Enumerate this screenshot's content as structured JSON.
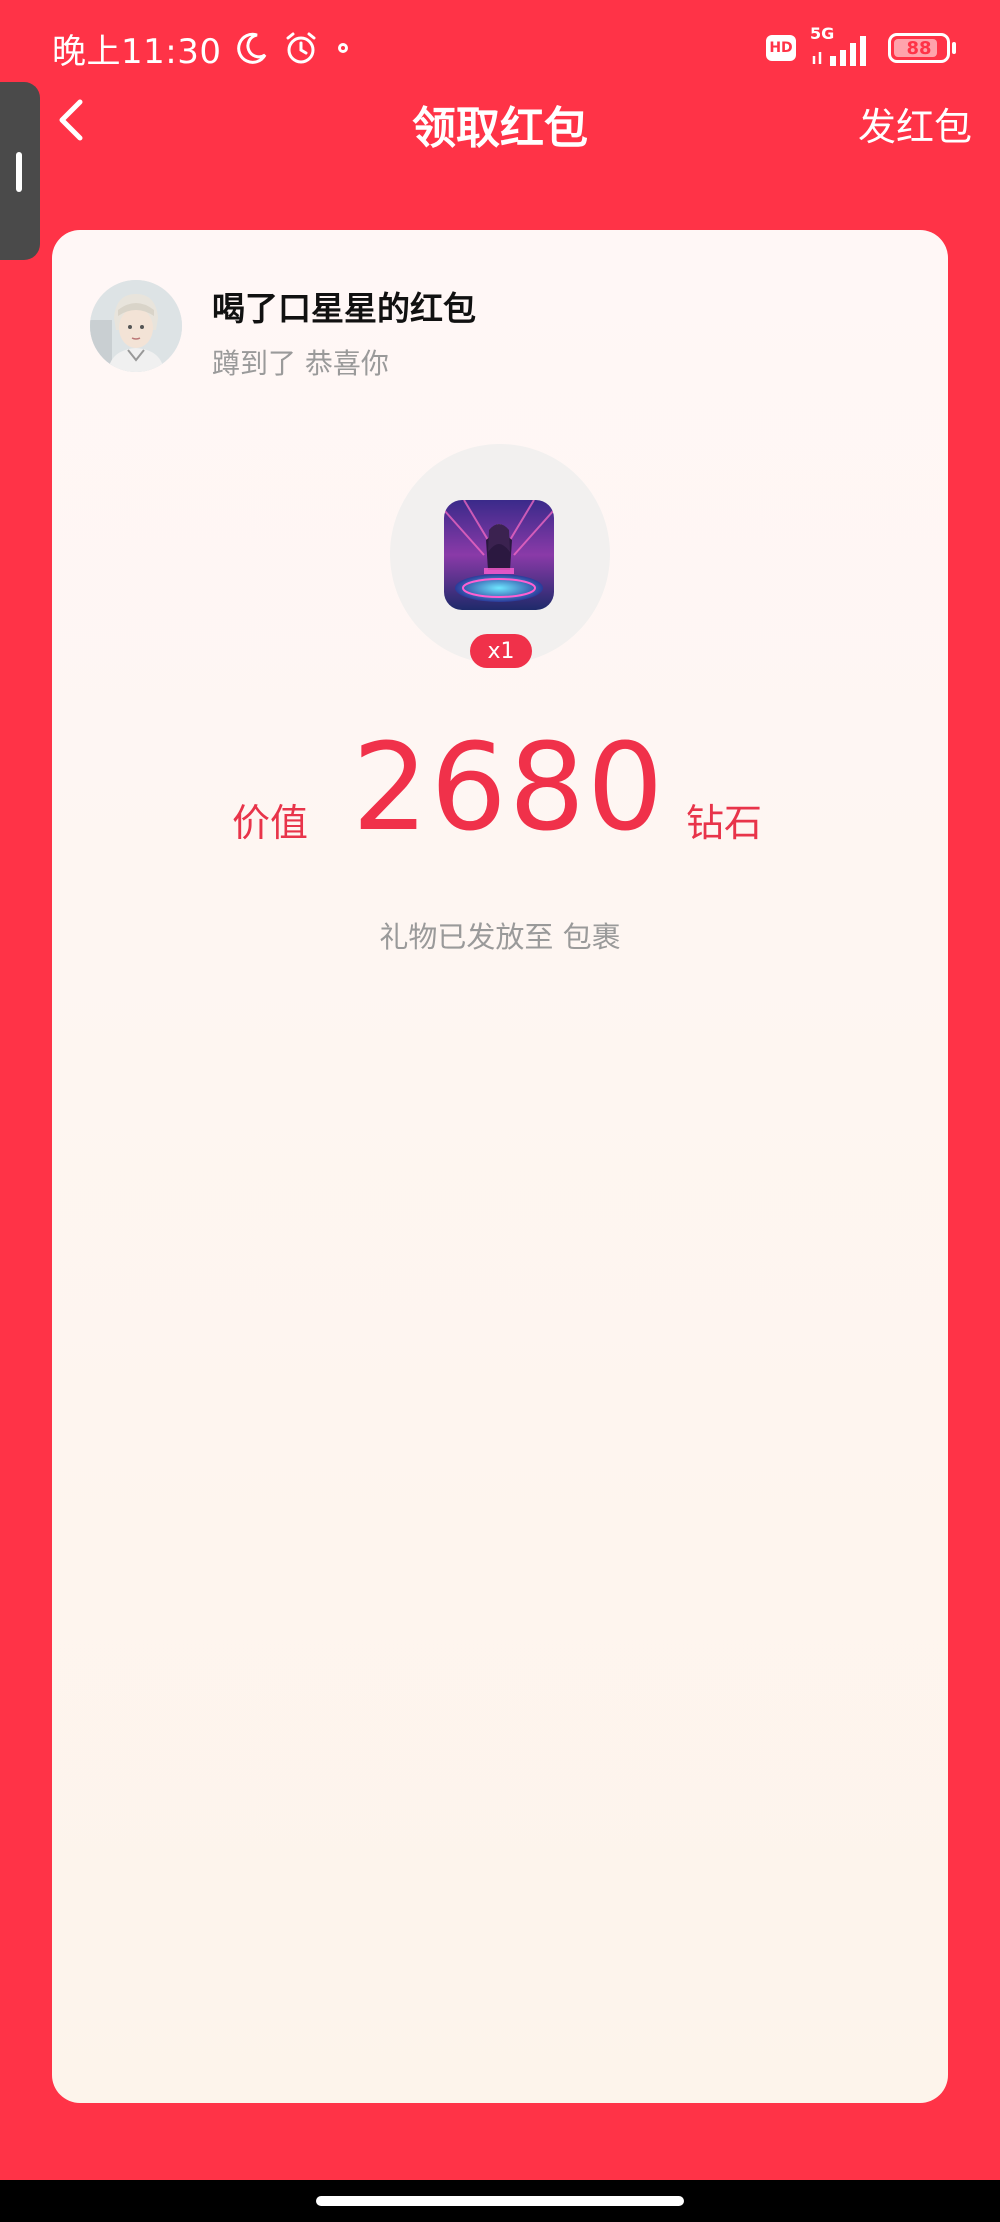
{
  "status_bar": {
    "time": "晚上11:30",
    "network": "5G",
    "hd": "HD",
    "battery": "88",
    "battery_level": 0.88,
    "icons": [
      "moon-icon",
      "alarm-icon",
      "notification-dot-icon",
      "hd-icon",
      "signal-icon",
      "battery-icon"
    ]
  },
  "header": {
    "title": "领取红包",
    "send_label": "发红包",
    "back_icon": "chevron-left-icon"
  },
  "sender": {
    "name": "喝了口星星的红包",
    "message": "蹲到了 恭喜你"
  },
  "gift": {
    "quantity": "x1",
    "value_prefix": "价值",
    "value": "2680",
    "value_unit": "钻石",
    "note": "礼物已发放至 包裹"
  },
  "colors": {
    "background": "#FF3347",
    "accent": "#F0314A",
    "card": "#FFF7F6",
    "muted_text": "#9a9a9a"
  }
}
